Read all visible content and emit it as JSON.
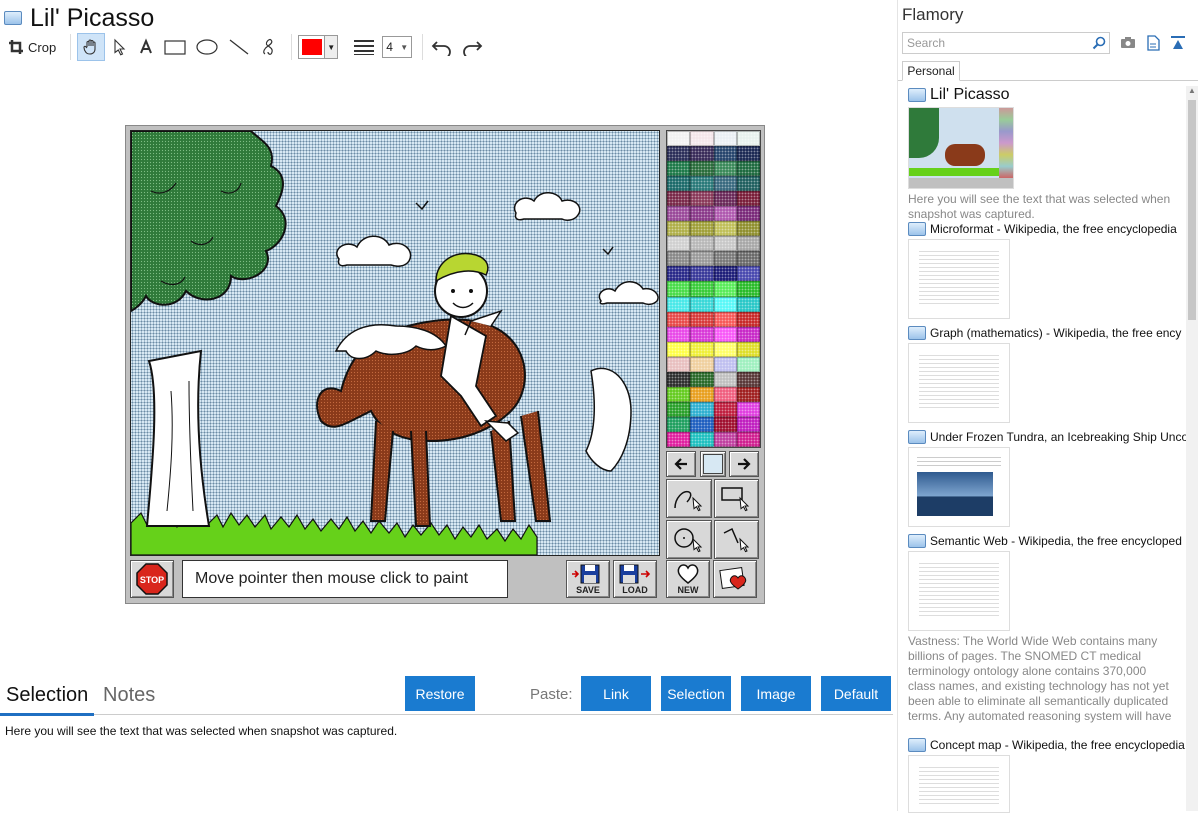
{
  "app": {
    "title": "Lil' Picasso"
  },
  "toolbar": {
    "crop_label": "Crop",
    "line_width_value": "4",
    "color": "#ff0000"
  },
  "snapshot": {
    "message": "Move pointer then mouse click to paint",
    "stop_label": "STOP",
    "save_label": "SAVE",
    "load_label": "LOAD",
    "new_label": "NEW"
  },
  "bottom": {
    "tab_selection": "Selection",
    "tab_notes": "Notes",
    "restore_label": "Restore",
    "paste_label": "Paste:",
    "link_label": "Link",
    "selection_label": "Selection",
    "image_label": "Image",
    "default_label": "Default",
    "selection_text": "Here you will see the text that was selected when snapshot was captured."
  },
  "sidebar": {
    "title": "Flamory",
    "search_placeholder": "Search",
    "tab_personal": "Personal",
    "items": [
      {
        "title": "Lil' Picasso",
        "snippet": "Here you will see the text that was selected when snapshot was captured."
      },
      {
        "title": "Microformat - Wikipedia, the free encyclopedia"
      },
      {
        "title": "Graph (mathematics) - Wikipedia, the free ency"
      },
      {
        "title": "Under Frozen Tundra, an Icebreaking Ship Unco"
      },
      {
        "title": "Semantic Web - Wikipedia, the free encycloped",
        "snippet": "Vastness: The World Wide Web contains many billions of pages. The SNOMED CT medical terminology ontology alone contains 370,000 class names, and existing technology has not yet been able to eliminate all semantically duplicated terms. Any automated reasoning system will have to deal with truly huge inputs."
      },
      {
        "title": "Concept map - Wikipedia, the free encyclopedia"
      }
    ]
  }
}
